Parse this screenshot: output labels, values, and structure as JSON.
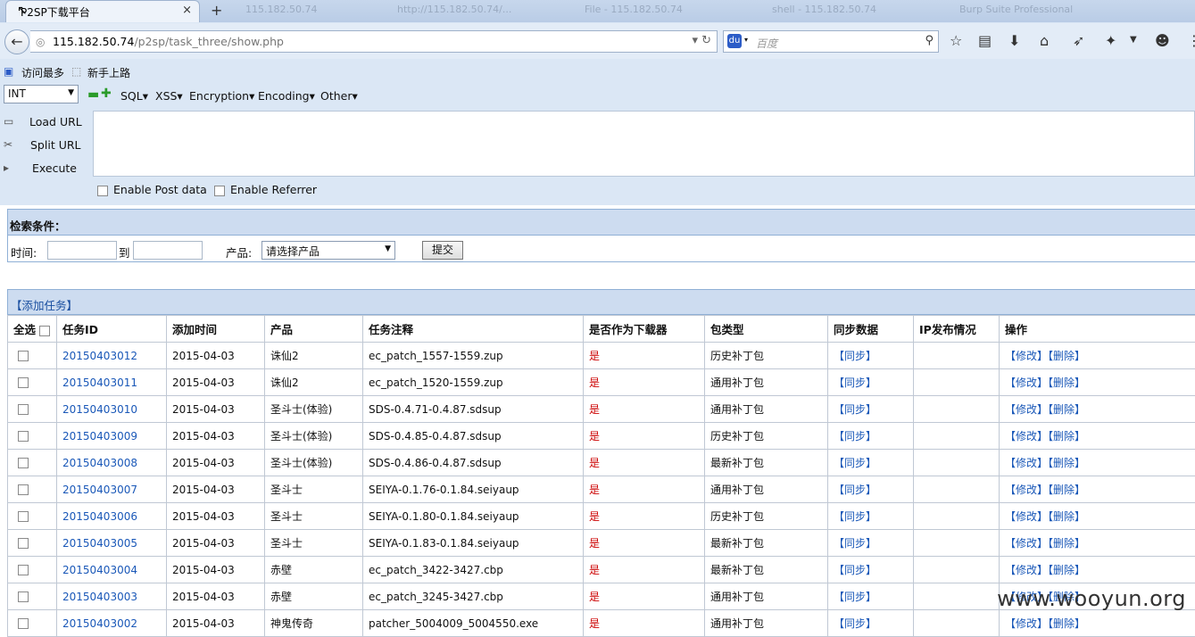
{
  "browser": {
    "active_tab_title": "P2SP下载平台",
    "tab_close": "×",
    "new_tab": "+",
    "background_tabs": [
      "115.182.50.74",
      "http://115.182.50.74/...",
      "File - 115.182.50.74",
      "shell - 115.182.50.74",
      "Burp Suite Professional"
    ],
    "url_host": "115.182.50.74",
    "url_path": "/p2sp/task_three/show.php",
    "search_placeholder": "百度",
    "bookmarks": [
      "访问最多",
      "新手上路"
    ]
  },
  "hackbar": {
    "type_select": "INT",
    "menus": [
      "SQL▾",
      "XSS▾",
      "Encryption▾",
      "Encoding▾",
      "Other▾"
    ],
    "side": [
      "Load URL",
      "Split URL",
      "Execute"
    ],
    "options": [
      "Enable Post data",
      "Enable Referrer"
    ]
  },
  "search": {
    "title": "检索条件：",
    "time_label": "时间:",
    "to_label": "到",
    "product_label": "产品:",
    "product_select": "请选择产品",
    "submit": "提交"
  },
  "tasks": {
    "add_link": "【添加任务】",
    "columns": [
      "全选",
      "任务ID",
      "添加时间",
      "产品",
      "任务注释",
      "是否作为下载器",
      "包类型",
      "同步数据",
      "IP发布情况",
      "操作"
    ],
    "sync_label": "【同步】",
    "edit_label": "【修改】",
    "delete_label": "【删除】",
    "rows": [
      {
        "id": "20150403012",
        "date": "2015-04-03",
        "product": "诛仙2",
        "note": "ec_patch_1557-1559.zup",
        "downloader": "是",
        "pkg": "历史补丁包"
      },
      {
        "id": "20150403011",
        "date": "2015-04-03",
        "product": "诛仙2",
        "note": "ec_patch_1520-1559.zup",
        "downloader": "是",
        "pkg": "通用补丁包"
      },
      {
        "id": "20150403010",
        "date": "2015-04-03",
        "product": "圣斗士(体验)",
        "note": "SDS-0.4.71-0.4.87.sdsup",
        "downloader": "是",
        "pkg": "通用补丁包"
      },
      {
        "id": "20150403009",
        "date": "2015-04-03",
        "product": "圣斗士(体验)",
        "note": "SDS-0.4.85-0.4.87.sdsup",
        "downloader": "是",
        "pkg": "历史补丁包"
      },
      {
        "id": "20150403008",
        "date": "2015-04-03",
        "product": "圣斗士(体验)",
        "note": "SDS-0.4.86-0.4.87.sdsup",
        "downloader": "是",
        "pkg": "最新补丁包"
      },
      {
        "id": "20150403007",
        "date": "2015-04-03",
        "product": "圣斗士",
        "note": "SEIYA-0.1.76-0.1.84.seiyaup",
        "downloader": "是",
        "pkg": "通用补丁包"
      },
      {
        "id": "20150403006",
        "date": "2015-04-03",
        "product": "圣斗士",
        "note": "SEIYA-0.1.80-0.1.84.seiyaup",
        "downloader": "是",
        "pkg": "历史补丁包"
      },
      {
        "id": "20150403005",
        "date": "2015-04-03",
        "product": "圣斗士",
        "note": "SEIYA-0.1.83-0.1.84.seiyaup",
        "downloader": "是",
        "pkg": "最新补丁包"
      },
      {
        "id": "20150403004",
        "date": "2015-04-03",
        "product": "赤壁",
        "note": "ec_patch_3422-3427.cbp",
        "downloader": "是",
        "pkg": "最新补丁包"
      },
      {
        "id": "20150403003",
        "date": "2015-04-03",
        "product": "赤壁",
        "note": "ec_patch_3245-3427.cbp",
        "downloader": "是",
        "pkg": "通用补丁包"
      },
      {
        "id": "20150403002",
        "date": "2015-04-03",
        "product": "神鬼传奇",
        "note": "patcher_5004009_5004550.exe",
        "downloader": "是",
        "pkg": "通用补丁包"
      }
    ]
  },
  "watermark": "www.wooyun.org"
}
